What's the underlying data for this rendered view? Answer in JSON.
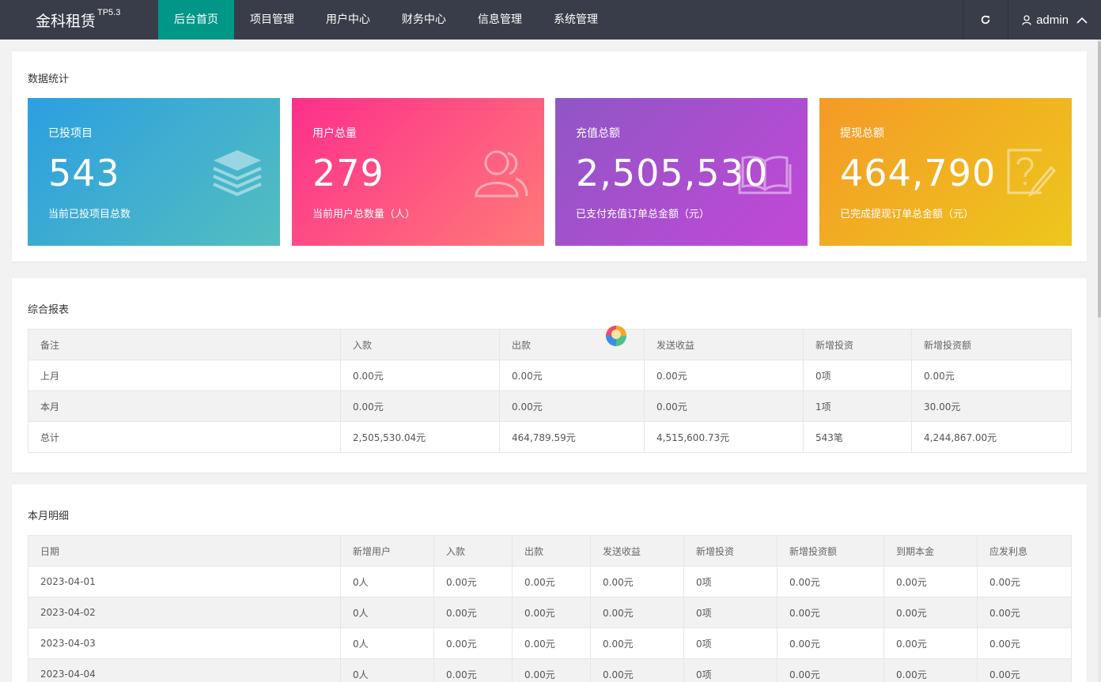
{
  "brand": {
    "name": "金科租赁",
    "version": "TP5.3"
  },
  "nav": {
    "items": [
      "后台首页",
      "项目管理",
      "用户中心",
      "财务中心",
      "信息管理",
      "系统管理"
    ],
    "active": 0
  },
  "user": {
    "name": "admin"
  },
  "icons": {
    "refresh": "refresh-icon",
    "user": "user-icon",
    "chevron": "chevron-up-icon"
  },
  "stats": {
    "title": "数据统计",
    "cards": [
      {
        "label": "已投项目",
        "value": "543",
        "desc": "当前已投项目总数",
        "icon": "layers-icon"
      },
      {
        "label": "用户总量",
        "value": "279",
        "desc": "当前用户总数量（人）",
        "icon": "users-icon"
      },
      {
        "label": "充值总额",
        "value": "2,505,530",
        "desc": "已支付充值订单总金额（元）",
        "icon": "book-icon"
      },
      {
        "label": "提现总额",
        "value": "464,790",
        "desc": "已完成提现订单总金额（元）",
        "icon": "question-note-icon"
      }
    ]
  },
  "report": {
    "title": "综合报表",
    "headers": [
      "备注",
      "入款",
      "出款",
      "发送收益",
      "新增投资",
      "新增投资额"
    ],
    "rows": [
      [
        "上月",
        "0.00元",
        "0.00元",
        "0.00元",
        "0项",
        "0.00元"
      ],
      [
        "本月",
        "0.00元",
        "0.00元",
        "0.00元",
        "1项",
        "30.00元"
      ],
      [
        "总计",
        "2,505,530.04元",
        "464,789.59元",
        "4,515,600.73元",
        "543笔",
        "4,244,867.00元"
      ]
    ]
  },
  "monthly": {
    "title": "本月明细",
    "headers": [
      "日期",
      "新增用户",
      "入款",
      "出款",
      "发送收益",
      "新增投资",
      "新增投资额",
      "到期本金",
      "应发利息"
    ],
    "rows": [
      [
        "2023-04-01",
        "0人",
        "0.00元",
        "0.00元",
        "0.00元",
        "0项",
        "0.00元",
        "0.00元",
        "0.00元"
      ],
      [
        "2023-04-02",
        "0人",
        "0.00元",
        "0.00元",
        "0.00元",
        "0项",
        "0.00元",
        "0.00元",
        "0.00元"
      ],
      [
        "2023-04-03",
        "0人",
        "0.00元",
        "0.00元",
        "0.00元",
        "0项",
        "0.00元",
        "0.00元",
        "0.00元"
      ],
      [
        "2023-04-04",
        "0人",
        "0.00元",
        "0.00元",
        "0.00元",
        "0项",
        "0.00元",
        "0.00元",
        "0.00元"
      ]
    ]
  },
  "colors": {
    "nav_bg": "#393d49",
    "nav_active": "#009688",
    "card1": [
      "#2c9fe0",
      "#53bec0"
    ],
    "card2": [
      "#fd2f8c",
      "#ff7a78"
    ],
    "card3": [
      "#8f56c6",
      "#c248d6"
    ],
    "card4": [
      "#f59a27",
      "#edc71c"
    ]
  }
}
